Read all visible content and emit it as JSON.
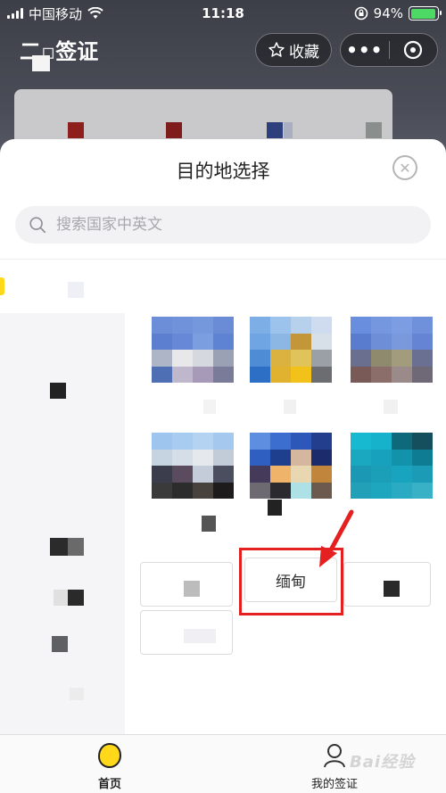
{
  "status_bar": {
    "carrier": "中国移动",
    "time": "11:18",
    "battery": "94%",
    "battery_level": 0.94
  },
  "header": {
    "title": "二",
    "title_suffix": "签证",
    "favorite_label": "收藏"
  },
  "sheet": {
    "title": "目的地选择",
    "search_placeholder": "搜索国家中英文"
  },
  "countries": {
    "btn1": "",
    "btn2": "缅甸",
    "btn3": ""
  },
  "tabbar": {
    "home": "首页",
    "my_visa": "我的签证"
  },
  "watermark": "Bai经验",
  "colors": {
    "accent": "#ffd81a",
    "highlight": "#e52020",
    "battery_green": "#4cd964"
  }
}
